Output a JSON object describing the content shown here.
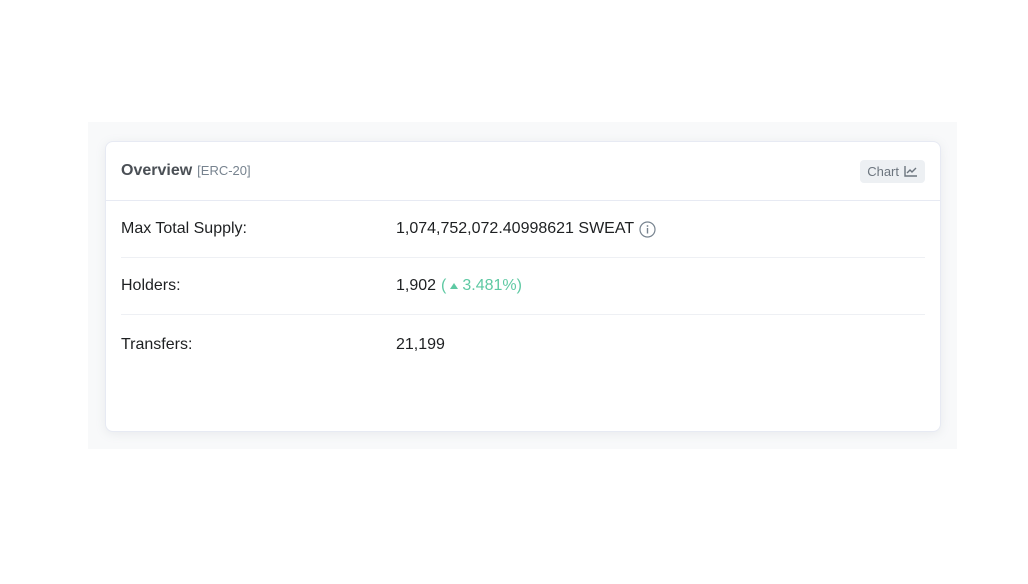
{
  "overview": {
    "title": "Overview",
    "token_standard": "[ERC-20]",
    "chart_button": "Chart",
    "rows": [
      {
        "label": "Max Total Supply:",
        "value": "1,074,752,072.40998621 SWEAT"
      },
      {
        "label": "Holders:",
        "value": "1,902",
        "change_open": "(",
        "change_value": "3.481%)",
        "change_color": "#5ec9a3",
        "change_icon": "triangle-up-icon"
      },
      {
        "label": "Transfers:",
        "value": "21,199"
      }
    ]
  }
}
